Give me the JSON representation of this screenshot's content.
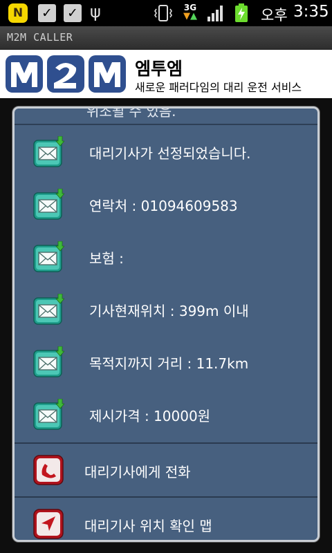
{
  "status_bar": {
    "kakao_glyph": "N",
    "network_label": "3G",
    "ampm": "오후",
    "time": "3:35"
  },
  "app_title": "M2M CALLER",
  "header": {
    "logo_text": "M2M",
    "brand_name": "엠투엠",
    "tagline": "새로운 패러다임의 대리 운전 서비스"
  },
  "dialog": {
    "partial_top_text": "위조될 수 있음.",
    "messages": [
      {
        "text": "대리기사가 선정되었습니다.",
        "icon": "mail-icon"
      },
      {
        "text": "연락처 : 01094609583",
        "icon": "mail-icon"
      },
      {
        "text": "보험 :",
        "icon": "mail-icon"
      },
      {
        "text": "기사현재위치 : 399m 이내",
        "icon": "mail-icon"
      },
      {
        "text": "목적지까지 거리 : 11.7km",
        "icon": "mail-icon"
      },
      {
        "text": "제시가격 : 10000원",
        "icon": "mail-icon"
      }
    ],
    "actions": [
      {
        "label": "대리기사에게 전화",
        "icon": "phone-icon"
      },
      {
        "label": "대리기사 위치 확인 맵",
        "icon": "location-arrow-icon"
      }
    ]
  },
  "colors": {
    "dialog_bg": "#47607f",
    "brand_blue": "#2f4f8f",
    "icon_teal": "#1f9e8c",
    "icon_red": "#b0121c"
  }
}
